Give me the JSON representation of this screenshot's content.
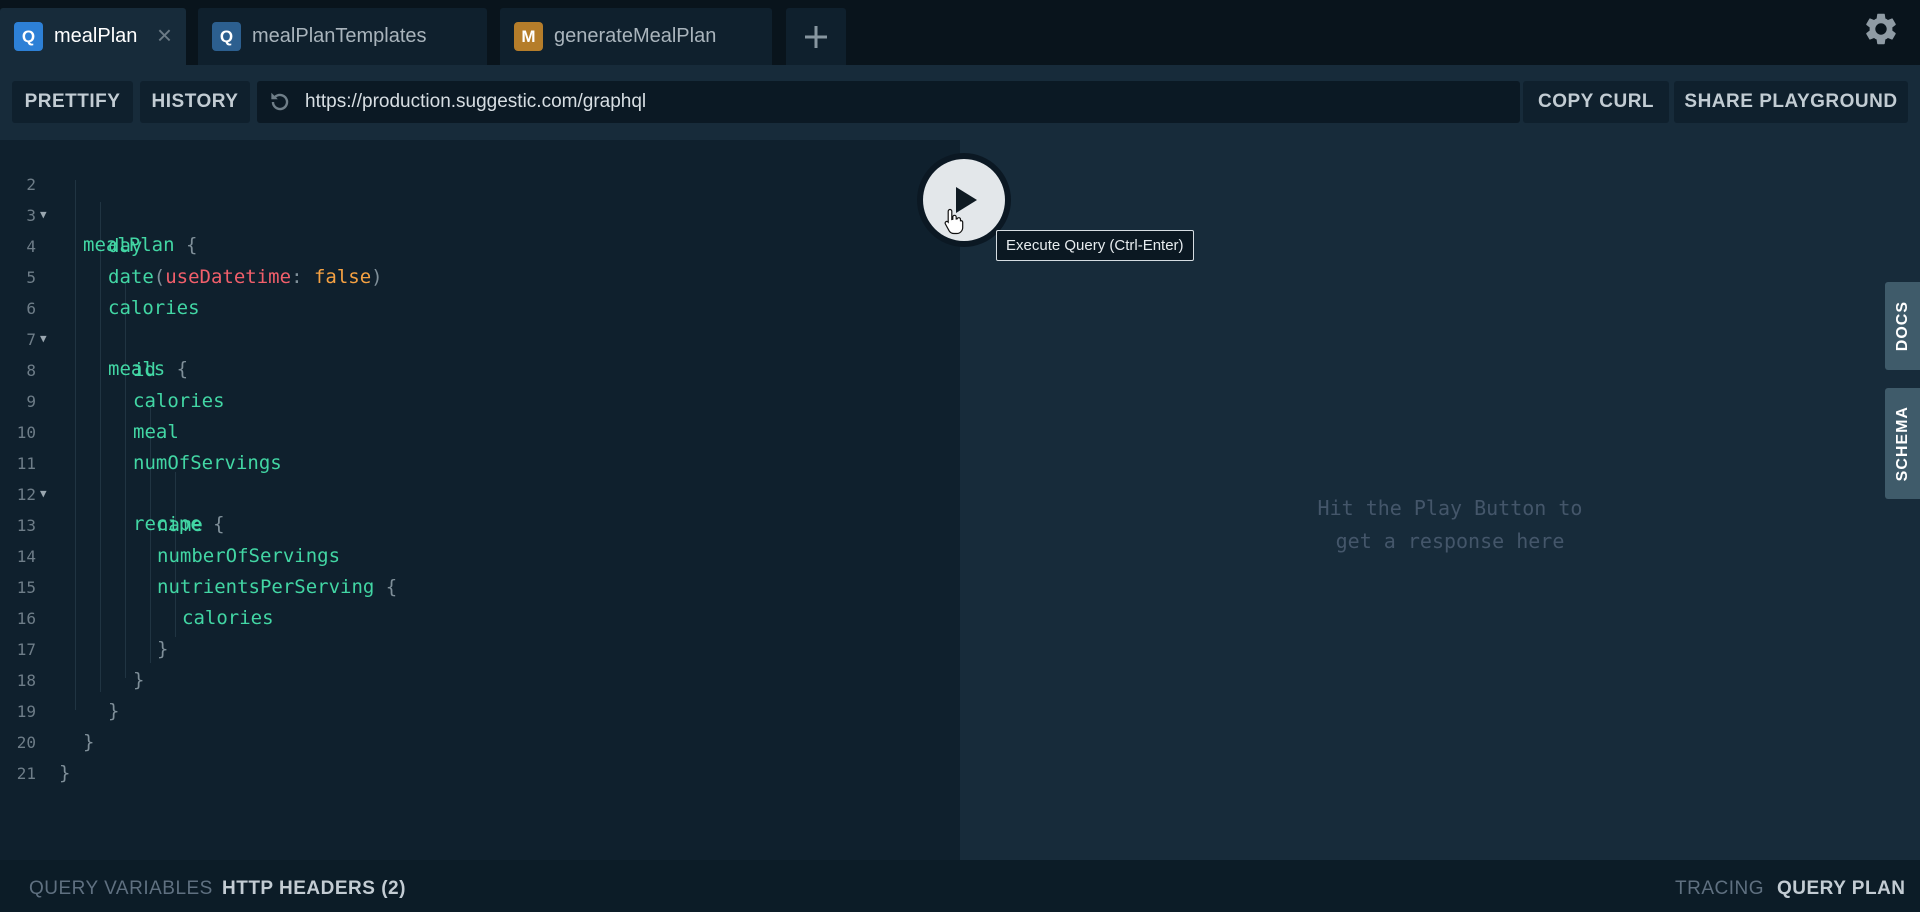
{
  "tabs": [
    {
      "badge": "Q",
      "label": "mealPlan",
      "badge_color": "#2d80d6",
      "active": true
    },
    {
      "badge": "Q",
      "label": "mealPlanTemplates",
      "badge_color": "#2c5f8f",
      "active": false
    },
    {
      "badge": "M",
      "label": "generateMealPlan",
      "badge_color": "#b57d2a",
      "active": false
    }
  ],
  "tab_add_icon": "plus-icon",
  "tab_close_icon": "close-icon",
  "settings_icon": "gear-icon",
  "toolbar": {
    "prettify": "PRETTIFY",
    "history": "HISTORY",
    "url": "https://production.suggestic.com/graphql",
    "copy_curl": "COPY CURL",
    "share_playground": "SHARE PLAYGROUND"
  },
  "editor": {
    "lines": [
      {
        "n": "2",
        "fold": true
      },
      {
        "n": "3"
      },
      {
        "n": "4"
      },
      {
        "n": "5"
      },
      {
        "n": "6",
        "fold": true
      },
      {
        "n": "7"
      },
      {
        "n": "8"
      },
      {
        "n": "9"
      },
      {
        "n": "10"
      },
      {
        "n": "11",
        "fold": true
      },
      {
        "n": "12"
      },
      {
        "n": "13"
      },
      {
        "n": "14"
      },
      {
        "n": "15"
      },
      {
        "n": "16"
      },
      {
        "n": "17"
      },
      {
        "n": "18"
      },
      {
        "n": "19"
      },
      {
        "n": "20"
      },
      {
        "n": "21"
      }
    ],
    "tokens": {
      "mealPlan": "mealPlan",
      "day": "day",
      "date": "date",
      "useDatetime": "useDatetime",
      "false_val": "false",
      "calories": "calories",
      "meals": "meals",
      "id": "id",
      "meal": "meal",
      "numOfServings": "numOfServings",
      "recipe": "recipe",
      "name": "name",
      "numberOfServings": "numberOfServings",
      "nutrientsPerServing": "nutrientsPerServing",
      "brace_open": "{",
      "brace_close": "}",
      "paren_open": "(",
      "paren_close": ")",
      "colon": ":"
    }
  },
  "run_button": {
    "icon": "play-icon",
    "tooltip": "Execute Query (Ctrl-Enter)"
  },
  "result": {
    "placeholder_line1": "Hit the Play Button to",
    "placeholder_line2": "get a response here"
  },
  "side_tabs": {
    "docs": "DOCS",
    "schema": "SCHEMA"
  },
  "bottom": {
    "query_variables": "QUERY VARIABLES",
    "http_headers": "HTTP HEADERS (2)",
    "tracing": "TRACING",
    "query_plan": "QUERY PLAN"
  }
}
